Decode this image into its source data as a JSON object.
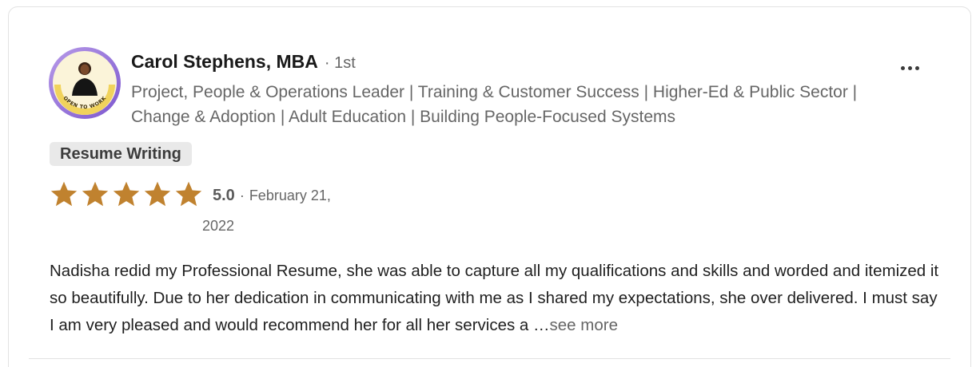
{
  "review": {
    "author": {
      "name": "Carol Stephens, MBA",
      "separator": "·",
      "connection_degree": "1st",
      "headline": "Project, People & Operations Leader | Training & Customer Success | Higher-Ed & Public Sector | Change & Adoption | Adult Education | Building People-Focused Systems",
      "avatar_badge_text": "OPEN TO WORK"
    },
    "service_tag": "Resume Writing",
    "rating": {
      "stars": 5,
      "max_stars": 5,
      "score": "5.0",
      "separator": "·",
      "date_line1": "February 21,",
      "date_line2": "2022"
    },
    "text": "Nadisha redid my Professional Resume, she was able to capture all my qualifications and skills and worded and itemized it so beautifully. Due to her dedication in communicating with me as I shared my expectations, she over delivered. I must say I am very pleased and would recommend her for all her services a …",
    "see_more_label": "see more",
    "more_icon": "more-horizontal-icon"
  },
  "colors": {
    "star": "#c0822f",
    "badge_ring": "#8a62d6",
    "badge_band": "#f1d35c",
    "tag_bg": "#e9e9e9",
    "muted_text": "#666666",
    "card_border": "#e2e2e2"
  }
}
